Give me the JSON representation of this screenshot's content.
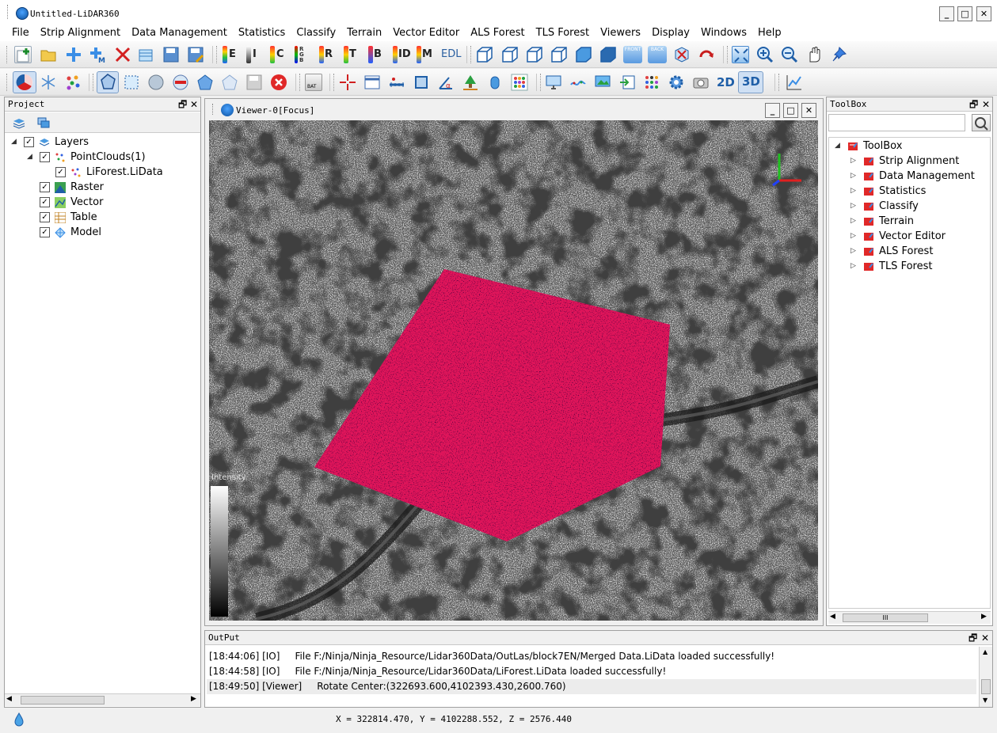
{
  "window": {
    "title": "Untitled-LiDAR360",
    "minimize": "_",
    "maximize": "□",
    "close": "✕"
  },
  "menu": [
    "File",
    "Strip Alignment",
    "Data Management",
    "Statistics",
    "Classify",
    "Terrain",
    "Vector Editor",
    "ALS Forest",
    "TLS Forest",
    "Viewers",
    "Display",
    "Windows",
    "Help"
  ],
  "toolbar1": {
    "letter_buttons": [
      "E",
      "I",
      "C",
      "RGB",
      "R",
      "T",
      "B",
      "ID",
      "M",
      "EDL"
    ],
    "view_front": "FRONT",
    "view_back": "BACK"
  },
  "toolbar2": {
    "mode_2d": "2D",
    "mode_3d": "3D",
    "bat_label": "BAT"
  },
  "project": {
    "title": "Project",
    "float_btn": "🗗",
    "close_btn": "✕",
    "tree": [
      {
        "label": "Layers",
        "checked": true,
        "expanded": true
      },
      {
        "label": "PointClouds(1)",
        "checked": true,
        "expanded": true
      },
      {
        "label": "LiForest.LiData",
        "checked": true
      },
      {
        "label": "Raster",
        "checked": true
      },
      {
        "label": "Vector",
        "checked": true
      },
      {
        "label": "Table",
        "checked": true
      },
      {
        "label": "Model",
        "checked": true
      }
    ]
  },
  "viewer": {
    "title": "Viewer-0[Focus]",
    "legend_label": "Intensity"
  },
  "toolbox": {
    "title": "ToolBox",
    "search_placeholder": "",
    "root": "ToolBox",
    "items": [
      "Strip Alignment",
      "Data Management",
      "Statistics",
      "Classify",
      "Terrain",
      "Vector Editor",
      "ALS Forest",
      "TLS Forest"
    ],
    "scroll_grip": "III"
  },
  "output": {
    "title": "OutPut",
    "lines": [
      "[18:44:06] [IO]     File F:/Ninja/Ninja_Resource/Lidar360Data/OutLas/block7EN/Merged Data.LiData loaded successfully!",
      "[18:44:58] [IO]     File F:/Ninja/Ninja_Resource/Lidar360Data/LiForest.LiData loaded successfully!",
      "[18:49:50] [Viewer]     Rotate Center:(322693.600,4102393.430,2600.760)"
    ]
  },
  "status": {
    "coords": "X = 322814.470, Y = 4102288.552, Z = 2576.440"
  },
  "colors": {
    "selection_polygon": "#e0155a",
    "accent": "#1f6fc4"
  }
}
